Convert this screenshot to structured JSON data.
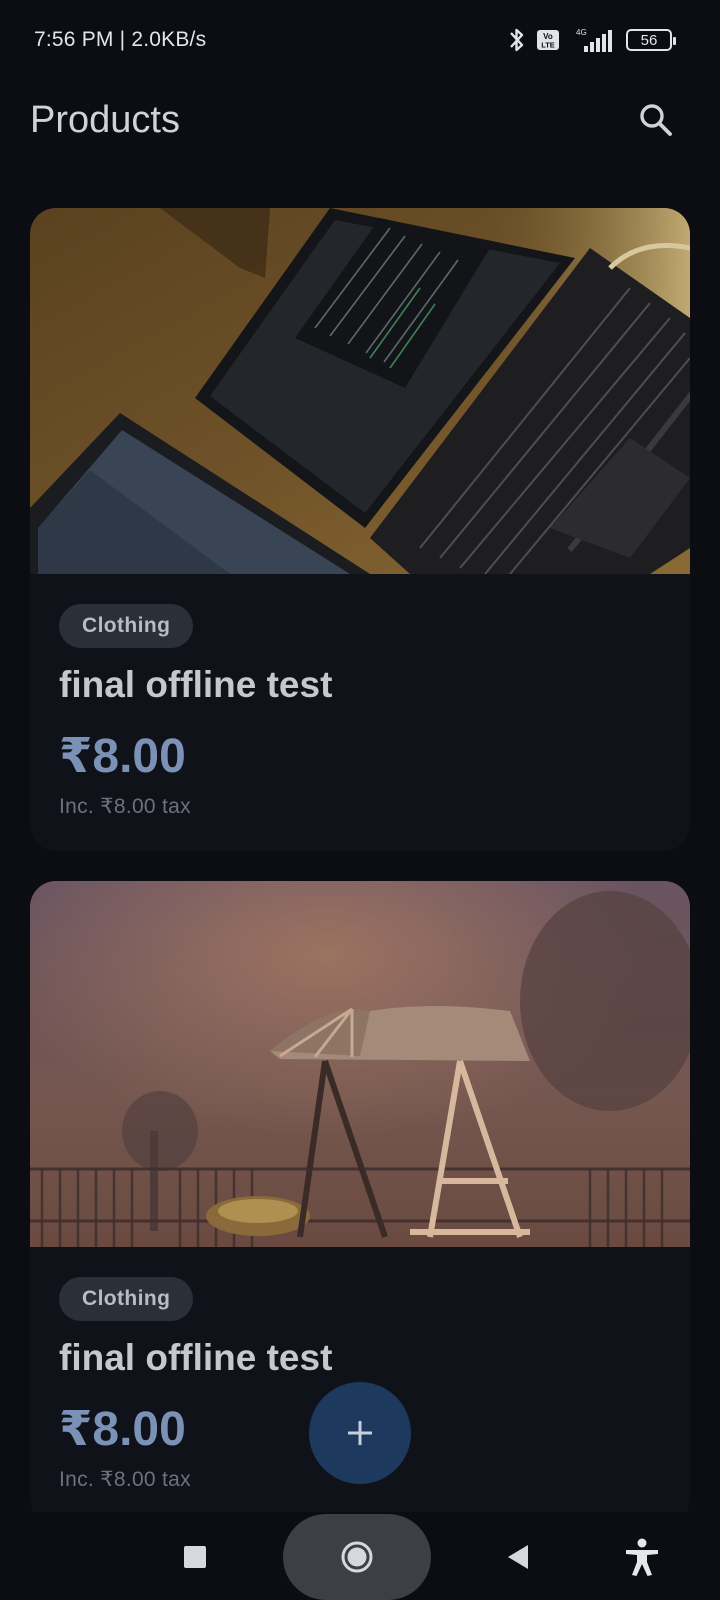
{
  "status_bar": {
    "time_speed": "7:56 PM | 2.0KB/s",
    "volte": "Vo LTE",
    "network": "4G",
    "battery": "56"
  },
  "app_bar": {
    "title": "Products",
    "search_icon": "search-icon"
  },
  "products": [
    {
      "image": "laptop-desk-photo",
      "category": "Clothing",
      "name": "final offline test",
      "price": "₹8.00",
      "tax": "Inc. ₹8.00 tax"
    },
    {
      "image": "foggy-swing-photo",
      "category": "Clothing",
      "name": "final offline test",
      "price": "₹8.00",
      "tax": "Inc. ₹8.00 tax"
    }
  ],
  "fab": {
    "icon": "plus-icon"
  },
  "nav_bar": {
    "recents_icon": "square-icon",
    "home_icon": "circle-icon",
    "back_icon": "triangle-back-icon",
    "accessibility_icon": "accessibility-icon"
  }
}
